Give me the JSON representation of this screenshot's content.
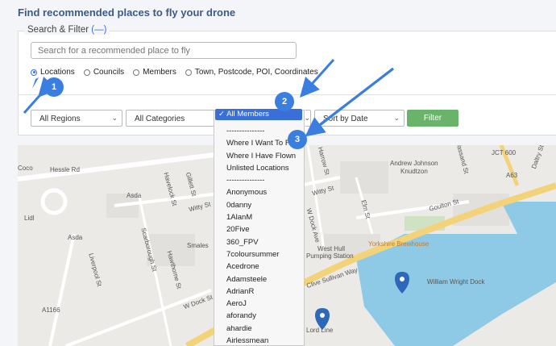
{
  "page": {
    "title": "Find recommended places to fly your drone"
  },
  "search_filter": {
    "legend": "Search & Filter",
    "toggle": "(—)",
    "search_placeholder": "Search for a recommended place to fly",
    "radios": [
      {
        "label": "Locations",
        "checked": true
      },
      {
        "label": "Councils",
        "checked": false
      },
      {
        "label": "Members",
        "checked": false
      },
      {
        "label": "Town, Postcode, POI, Coordinates",
        "checked": false
      }
    ],
    "selects": {
      "regions": "All Regions",
      "categories": "All Categories",
      "members": "✓ All Members",
      "sort": "Sort by Date"
    },
    "filter_button": "Filter"
  },
  "members_dropdown": {
    "options": [
      "---------------",
      "Where I Want To Fly",
      "Where I Have Flown",
      "Unlisted Locations",
      "---------------",
      "Anonymous",
      "0danny",
      "1AlanM",
      "20Five",
      "360_FPV",
      "7coloursummer",
      "Acedrone",
      "Adamsteele",
      "AdrianR",
      "AeroJ",
      "aforandy",
      "ahardie",
      "Airlessmean"
    ]
  },
  "annotations": {
    "badge1": "1",
    "badge2": "2",
    "badge3": "3"
  },
  "map": {
    "labels": {
      "hessle_rd": "Hessle Rd",
      "asda1": "Asda",
      "asda2": "Asda",
      "lidl": "Lidl",
      "havelock": "Havelock St",
      "gillett": "Gillett St",
      "witty1": "Witty St",
      "witty2": "Witty St",
      "liverpool": "Liverpool St",
      "scarborough": "Scarborough St",
      "hawthorne": "Hawthorne St",
      "smales": "Smales",
      "wdock": "W Dock St",
      "wdockave": "W Dock Ave",
      "harrow": "Harrow St",
      "elm": "Elm St",
      "andrew": "Andrew Johnson",
      "knudtzon": "Knudtzon",
      "goulton": "Goulton St",
      "westhull": "West Hull",
      "pumping": "Pumping Station",
      "yorkshire": "Yorkshire Brewhouse",
      "clive": "Clive Sullivan Way",
      "william": "William Wright Dock",
      "lordline": "Lord Line",
      "wassand": "Wassand St",
      "jct": "JCT 600",
      "daltry": "Daltry St",
      "coco": "Coco",
      "a63": "A63",
      "a1166": "A1166"
    }
  },
  "colors": {
    "accent": "#3a7fe0",
    "title": "#3a5a8c",
    "filter": "#6ab36a",
    "water": "#8ecae6",
    "road": "#f3d37a"
  }
}
